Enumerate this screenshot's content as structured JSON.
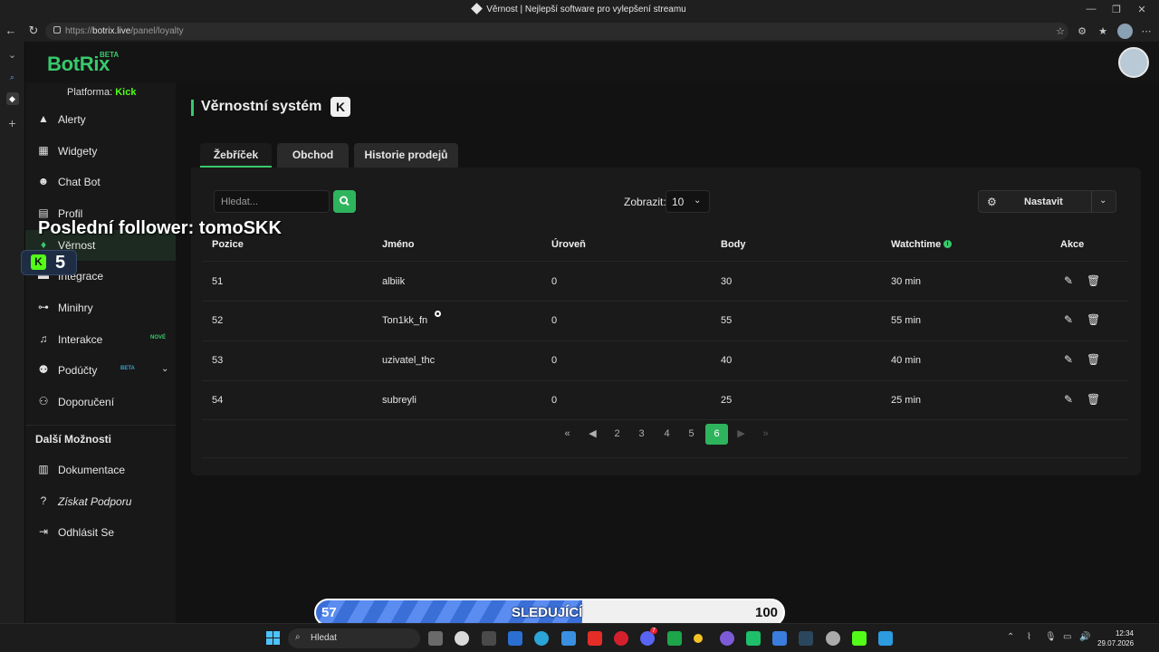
{
  "browser": {
    "window_title": "Věrnost | Nejlepší software pro vylepšení streamu",
    "url_prefix": "https://",
    "url_host": "botrix.live",
    "url_path": "/panel/loyalty"
  },
  "brand": {
    "logo": "BotRix",
    "beta": "BETA",
    "accent": "#38c96b"
  },
  "sidebar": {
    "platform_label": "Platforma:",
    "platform_value": "Kick",
    "items": [
      {
        "label": "Alerty",
        "icon": "warning-icon"
      },
      {
        "label": "Widgety",
        "icon": "grid-icon"
      },
      {
        "label": "Chat Bot",
        "icon": "robot-icon"
      },
      {
        "label": "Profil",
        "icon": "id-card-icon"
      },
      {
        "label": "Věrnost",
        "icon": "gift-icon"
      },
      {
        "label": "Integrace",
        "icon": "plug-icon"
      },
      {
        "label": "Minihry",
        "icon": "gamepad-icon"
      },
      {
        "label": "Interakce",
        "icon": "music-icon",
        "badge": "NOVÉ"
      },
      {
        "label": "Podúčty",
        "icon": "users-cog-icon",
        "badge": "BETA"
      },
      {
        "label": "Doporučení",
        "icon": "users-icon"
      }
    ],
    "section_label": "Další Možnosti",
    "extra_items": [
      {
        "label": "Dokumentace",
        "icon": "scroll-icon"
      },
      {
        "label": "Získat Podporu",
        "icon": "question-icon"
      },
      {
        "label": "Odhlásit Se",
        "icon": "logout-icon"
      }
    ]
  },
  "main": {
    "title": "Věrnostní systém",
    "title_badge": "K",
    "tabs": [
      "Žebříček",
      "Obchod",
      "Historie prodejů"
    ],
    "search_placeholder": "Hledat...",
    "show_label": "Zobrazit:",
    "show_value": "10",
    "settings_label": "Nastavit",
    "table": {
      "headers": [
        "Pozice",
        "Jméno",
        "Úroveň",
        "Body",
        "Watchtime",
        "Akce"
      ],
      "rows": [
        {
          "position": "51",
          "name": "albiik",
          "level": "0",
          "points": "30",
          "watchtime": "30 min"
        },
        {
          "position": "52",
          "name": "Ton1kk_fn",
          "level": "0",
          "points": "55",
          "watchtime": "55 min"
        },
        {
          "position": "53",
          "name": "uzivatel_thc",
          "level": "0",
          "points": "40",
          "watchtime": "40 min"
        },
        {
          "position": "54",
          "name": "subreyli",
          "level": "0",
          "points": "25",
          "watchtime": "25 min"
        }
      ]
    },
    "pagination": {
      "pages": [
        "2",
        "3",
        "4",
        "5",
        "6"
      ],
      "current": "6"
    }
  },
  "overlay": {
    "last_follower": "Poslední follower: tomoSKK",
    "kick_count": "5",
    "goal": {
      "current": "57",
      "label": "SLEDUJÍCÍ",
      "target": "100",
      "progress": 0.57
    }
  },
  "taskbar": {
    "search": "Hledat",
    "time": "12:34",
    "date": "29.07.2026",
    "discord_badge": "7"
  }
}
